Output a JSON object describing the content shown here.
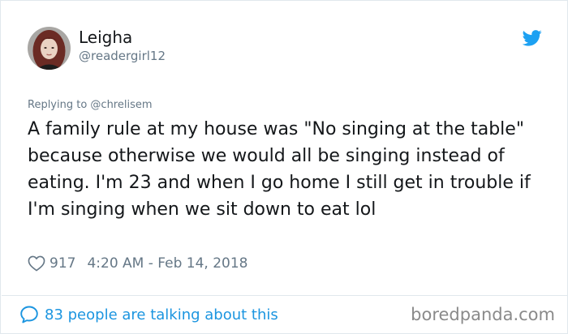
{
  "user": {
    "display_name": "Leigha",
    "handle": "@readergirl12"
  },
  "tweet": {
    "reply_context": "Replying to @chrelisem",
    "text": "A family rule at my house was \"No singing at the table\" because otherwise we would all be singing instead of eating. I'm 23 and when I go home I still get in trouble if I'm singing when we sit down to eat lol",
    "likes": "917",
    "timestamp": "4:20 AM - Feb 14, 2018"
  },
  "footer": {
    "talking_label": "83 people are talking about this"
  },
  "watermark": "boredpanda.com",
  "icons": {
    "logo": "twitter-bird-icon",
    "like": "heart-icon",
    "reply": "speech-bubble-icon"
  },
  "colors": {
    "twitter_blue": "#1da1f2",
    "link_blue": "#1b95e0",
    "secondary_text": "#657786",
    "primary_text": "#14171a"
  }
}
